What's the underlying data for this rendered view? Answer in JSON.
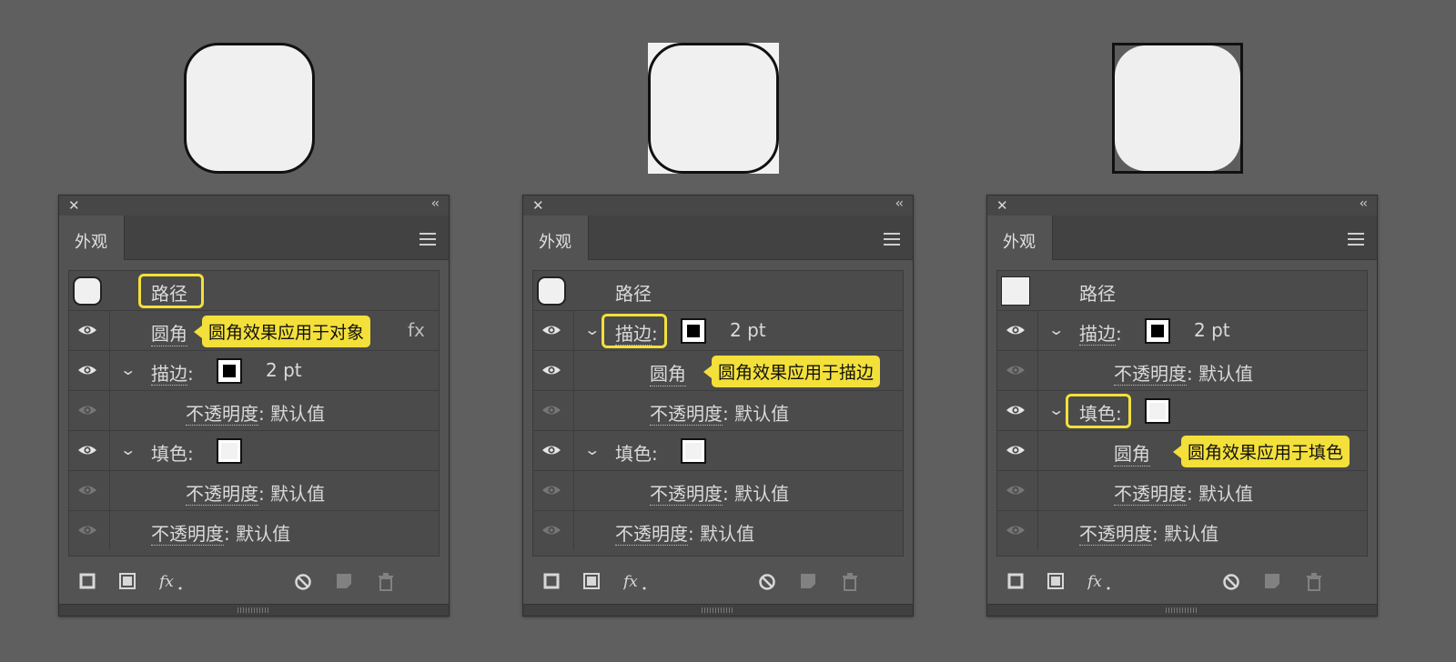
{
  "panels": [
    {
      "title": "外观",
      "object_label": "路径",
      "rows": [
        {
          "kind": "effect",
          "label": "圆角",
          "callout": "圆角效果应用于对象",
          "fx": "fx"
        },
        {
          "kind": "stroke",
          "label": "描边",
          "colon": ":",
          "value": "2 pt"
        },
        {
          "kind": "opacity-nested",
          "label": "不透明度",
          "colon": ":",
          "value": "默认值"
        },
        {
          "kind": "fill",
          "label": "填色",
          "colon": ":"
        },
        {
          "kind": "opacity-nested",
          "label": "不透明度",
          "colon": ":",
          "value": "默认值"
        },
        {
          "kind": "opacity",
          "label": "不透明度",
          "colon": ":",
          "value": "默认值"
        }
      ]
    },
    {
      "title": "外观",
      "object_label": "路径",
      "rows": [
        {
          "kind": "stroke",
          "label": "描边",
          "colon": ":",
          "value": "2 pt"
        },
        {
          "kind": "effect-nested",
          "label": "圆角",
          "callout": "圆角效果应用于描边"
        },
        {
          "kind": "opacity-nested",
          "label": "不透明度",
          "colon": ":",
          "value": "默认值"
        },
        {
          "kind": "fill",
          "label": "填色",
          "colon": ":"
        },
        {
          "kind": "opacity-nested",
          "label": "不透明度",
          "colon": ":",
          "value": "默认值"
        },
        {
          "kind": "opacity",
          "label": "不透明度",
          "colon": ":",
          "value": "默认值"
        }
      ]
    },
    {
      "title": "外观",
      "object_label": "路径",
      "rows": [
        {
          "kind": "stroke",
          "label": "描边",
          "colon": ":",
          "value": "2 pt"
        },
        {
          "kind": "opacity-nested",
          "label": "不透明度",
          "colon": ":",
          "value": "默认值"
        },
        {
          "kind": "fill",
          "label": "填色",
          "colon": ":"
        },
        {
          "kind": "effect-nested",
          "label": "圆角",
          "callout": "圆角效果应用于填色"
        },
        {
          "kind": "opacity-nested",
          "label": "不透明度",
          "colon": ":",
          "value": "默认值"
        },
        {
          "kind": "opacity",
          "label": "不透明度",
          "colon": ":",
          "value": "默认值"
        }
      ]
    }
  ],
  "colors": {
    "highlight": "#f3e03a",
    "panel_bg": "#535353",
    "canvas_bg": "#5f5f5f"
  }
}
